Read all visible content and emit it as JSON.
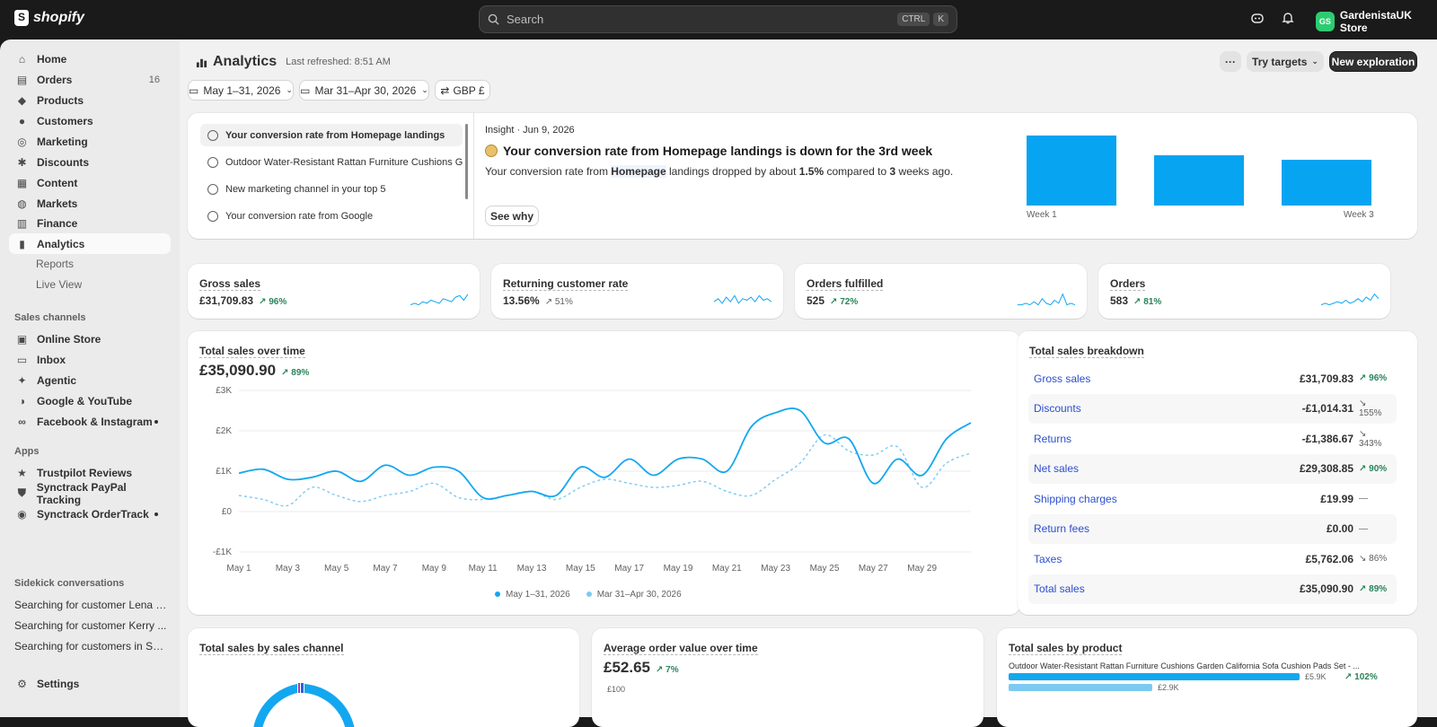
{
  "topbar": {
    "brand": "shopify",
    "search_placeholder": "Search",
    "kbd1": "CTRL",
    "kbd2": "K",
    "store_initials": "GS",
    "store_name": "GardenistaUK Store"
  },
  "sidebar": {
    "items": [
      {
        "label": "Home",
        "icon": "home-icon"
      },
      {
        "label": "Orders",
        "icon": "orders-icon",
        "badge": "16"
      },
      {
        "label": "Products",
        "icon": "tag-icon"
      },
      {
        "label": "Customers",
        "icon": "person-icon"
      },
      {
        "label": "Marketing",
        "icon": "target-icon"
      },
      {
        "label": "Discounts",
        "icon": "discount-icon"
      },
      {
        "label": "Content",
        "icon": "content-icon"
      },
      {
        "label": "Markets",
        "icon": "globe-icon"
      },
      {
        "label": "Finance",
        "icon": "bank-icon"
      },
      {
        "label": "Analytics",
        "icon": "chart-icon"
      }
    ],
    "sub": [
      "Reports",
      "Live View"
    ],
    "sales_channels_label": "Sales channels",
    "channels": [
      {
        "label": "Online Store",
        "icon": "store-icon"
      },
      {
        "label": "Inbox",
        "icon": "inbox-icon"
      },
      {
        "label": "Agentic",
        "icon": "agentic-icon"
      },
      {
        "label": "Google & YouTube",
        "icon": "google-icon"
      },
      {
        "label": "Facebook & Instagram",
        "icon": "meta-icon"
      }
    ],
    "apps_label": "Apps",
    "apps": [
      {
        "label": "Trustpilot Reviews",
        "icon": "star-icon"
      },
      {
        "label": "Synctrack PayPal Tracking",
        "icon": "shield-icon"
      },
      {
        "label": "Synctrack OrderTrack",
        "icon": "track-icon"
      }
    ],
    "sidekick_label": "Sidekick conversations",
    "conversations": [
      "Searching for customer Lena B...",
      "Searching for customer Kerry ...",
      "Searching for customers in Sh..."
    ],
    "settings": "Settings"
  },
  "header": {
    "title": "Analytics",
    "refreshed": "Last refreshed: 8:51 AM",
    "more": "···",
    "targets": "Try targets",
    "new": "New exploration"
  },
  "filters": {
    "date": "May 1–31, 2026",
    "compare": "Mar 31–Apr 30, 2026",
    "currency": "GBP £"
  },
  "insights": {
    "list": [
      "Your conversion rate from Homepage landings",
      "Outdoor Water-Resistant Rattan Furniture Cushions G...",
      "New marketing channel in your top 5",
      "Your conversion rate from Google"
    ],
    "meta": "Insight · Jun 9, 2026",
    "headline": "Your conversion rate from Homepage landings is down for the 3rd week",
    "body_pre": "Your conversion rate from ",
    "body_kw": "Homepage",
    "body_mid": " landings dropped by about ",
    "body_pct": "1.5%",
    "body_mid2": " compared to ",
    "body_n": "3",
    "body_post": " weeks ago.",
    "see_why": "See why",
    "bars": {
      "week1": "Week 1",
      "week3": "Week 3",
      "values": [
        1.0,
        0.72,
        0.66
      ]
    }
  },
  "kpis": [
    {
      "title": "Gross sales",
      "value": "£31,709.83",
      "change": "96%"
    },
    {
      "title": "Returning customer rate",
      "value": "13.56%",
      "change": "51%",
      "down": true
    },
    {
      "title": "Orders fulfilled",
      "value": "525",
      "change": "72%"
    },
    {
      "title": "Orders",
      "value": "583",
      "change": "81%"
    }
  ],
  "sales_over_time": {
    "title": "Total sales over time",
    "value": "£35,090.90",
    "change": "89%",
    "legend": [
      "May 1–31, 2026",
      "Mar 31–Apr 30, 2026"
    ]
  },
  "chart_data": {
    "type": "line",
    "title": "Total sales over time",
    "x": [
      "May 1",
      "May 2",
      "May 3",
      "May 4",
      "May 5",
      "May 6",
      "May 7",
      "May 8",
      "May 9",
      "May 10",
      "May 11",
      "May 12",
      "May 13",
      "May 14",
      "May 15",
      "May 16",
      "May 17",
      "May 18",
      "May 19",
      "May 20",
      "May 21",
      "May 22",
      "May 23",
      "May 24",
      "May 25",
      "May 26",
      "May 27",
      "May 28",
      "May 29",
      "May 30",
      "May 31"
    ],
    "xticks": [
      "May 1",
      "May 3",
      "May 5",
      "May 7",
      "May 9",
      "May 11",
      "May 13",
      "May 15",
      "May 17",
      "May 19",
      "May 21",
      "May 23",
      "May 25",
      "May 27",
      "May 29"
    ],
    "yticks": [
      "£3K",
      "£2K",
      "£1K",
      "£0",
      "-£1K"
    ],
    "ylim": [
      -1000,
      3000
    ],
    "series": [
      {
        "name": "May 1–31, 2026",
        "values": [
          950,
          1050,
          800,
          850,
          1000,
          750,
          1150,
          900,
          1100,
          1000,
          350,
          400,
          500,
          400,
          1100,
          850,
          1300,
          900,
          1300,
          1300,
          1000,
          2100,
          2450,
          2500,
          1700,
          1800,
          700,
          1300,
          900,
          1800,
          2200
        ]
      },
      {
        "name": "Mar 31–Apr 30, 2026",
        "values": [
          400,
          300,
          150,
          600,
          400,
          250,
          400,
          500,
          700,
          350,
          300,
          400,
          500,
          300,
          600,
          800,
          700,
          600,
          650,
          750,
          500,
          400,
          800,
          1200,
          1900,
          1500,
          1400,
          1600,
          600,
          1200,
          1450
        ]
      }
    ],
    "colors": [
      "#13a7f0",
      "#7ccaf2"
    ]
  },
  "breakdown": {
    "title": "Total sales breakdown",
    "rows": [
      {
        "label": "Gross sales",
        "value": "£31,709.83",
        "change": "96%",
        "dir": "up"
      },
      {
        "label": "Discounts",
        "value": "-£1,014.31",
        "change": "155%",
        "dir": "dn"
      },
      {
        "label": "Returns",
        "value": "-£1,386.67",
        "change": "343%",
        "dir": "dn"
      },
      {
        "label": "Net sales",
        "value": "£29,308.85",
        "change": "90%",
        "dir": "up"
      },
      {
        "label": "Shipping charges",
        "value": "£19.99",
        "change": "—",
        "dir": "none"
      },
      {
        "label": "Return fees",
        "value": "£0.00",
        "change": "—",
        "dir": "none"
      },
      {
        "label": "Taxes",
        "value": "£5,762.06",
        "change": "86%",
        "dir": "dn"
      },
      {
        "label": "Total sales",
        "value": "£35,090.90",
        "change": "89%",
        "dir": "up"
      }
    ]
  },
  "bottom": {
    "channel_title": "Total sales by sales channel",
    "aov_title": "Average order value over time",
    "aov_value": "£52.65",
    "aov_change": "7%",
    "aov_tick": "£100",
    "product_title": "Total sales by product",
    "product_name": "Outdoor Water-Resistant Rattan Furniture Cushions Garden California Sofa Cushion Pads Set - ...",
    "product_v1": "£5.9K",
    "product_v2": "£2.9K",
    "product_change": "102%"
  }
}
